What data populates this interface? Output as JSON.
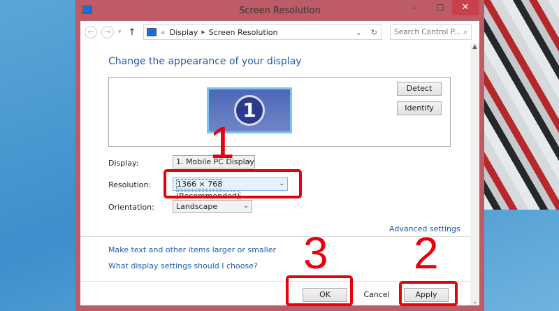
{
  "window": {
    "title": "Screen Resolution",
    "minimize": "–",
    "maximize": "☐",
    "close": "✕"
  },
  "nav": {
    "back": "←",
    "forward": "→",
    "recent": "▾",
    "up": "↑",
    "breadcrumb_prefix": "«",
    "breadcrumb": [
      "Display",
      "Screen Resolution"
    ],
    "refresh": "↻",
    "dropdown": "⌄",
    "search_placeholder": "Search Control P...",
    "search_icon": "⌕"
  },
  "heading": "Change the appearance of your display",
  "monitor_number": "1",
  "buttons": {
    "detect": "Detect",
    "identify": "Identify",
    "ok": "OK",
    "cancel": "Cancel",
    "apply": "Apply"
  },
  "fields": {
    "display_label": "Display:",
    "display_value": "1. Mobile PC Display",
    "resolution_label": "Resolution:",
    "resolution_value": "1366 × 768 (Recommended)",
    "orientation_label": "Orientation:",
    "orientation_value": "Landscape"
  },
  "links": {
    "advanced": "Advanced settings",
    "larger": "Make text and other items larger or smaller",
    "which": "What display settings should I choose?"
  },
  "annotations": [
    "1",
    "2",
    "3"
  ],
  "colors": {
    "annotation": "#e8000d",
    "titlebar": "#bd5b66",
    "link": "#1e5bb0"
  }
}
